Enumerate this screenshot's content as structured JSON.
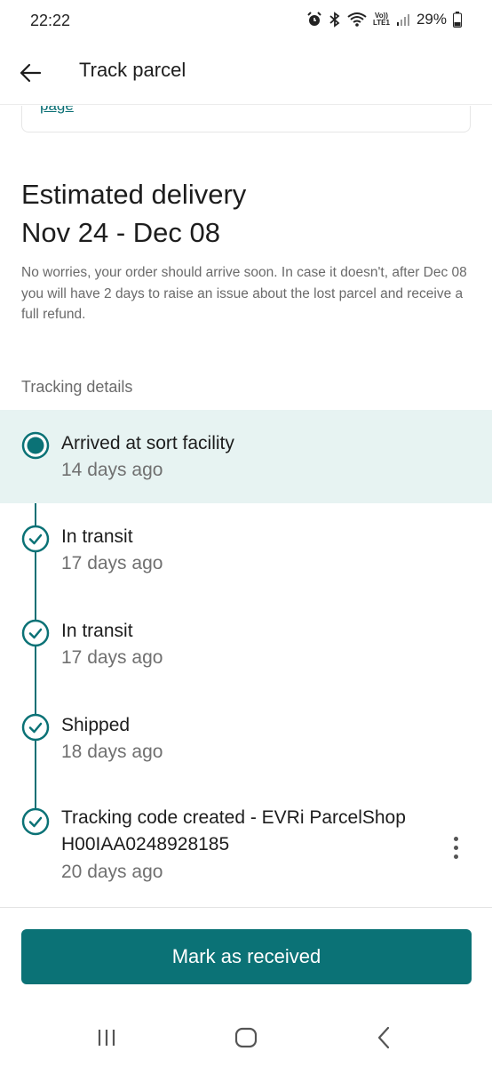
{
  "status_bar": {
    "time": "22:22",
    "lte_top": "Vo))",
    "lte_bottom": "LTE1",
    "battery": "29%"
  },
  "app_bar": {
    "title": "Track parcel",
    "back_icon": "arrow-left-icon"
  },
  "previous_card": {
    "link_text": "page"
  },
  "estimate": {
    "title": "Estimated delivery",
    "dates": "Nov 24 - Dec 08",
    "note": "No worries, your order should arrive soon. In case it doesn't, after Dec 08 you will have 2 days to raise an issue about the lost parcel and receive a full refund."
  },
  "tracking": {
    "section_label": "Tracking details",
    "events": [
      {
        "title": "Arrived at sort facility",
        "time": "14 days ago",
        "current": true
      },
      {
        "title": "In transit",
        "time": "17 days ago",
        "current": false
      },
      {
        "title": "In transit",
        "time": "17 days ago",
        "current": false
      },
      {
        "title": "Shipped",
        "time": "18 days ago",
        "current": false
      },
      {
        "title": "Tracking code created - EVRi ParcelShop H00IAA0248928185",
        "time": "20 days ago",
        "current": false
      }
    ]
  },
  "actions": {
    "mark_received": "Mark as received"
  },
  "colors": {
    "accent": "#0b7276",
    "current_bg": "#e7f3f2"
  }
}
